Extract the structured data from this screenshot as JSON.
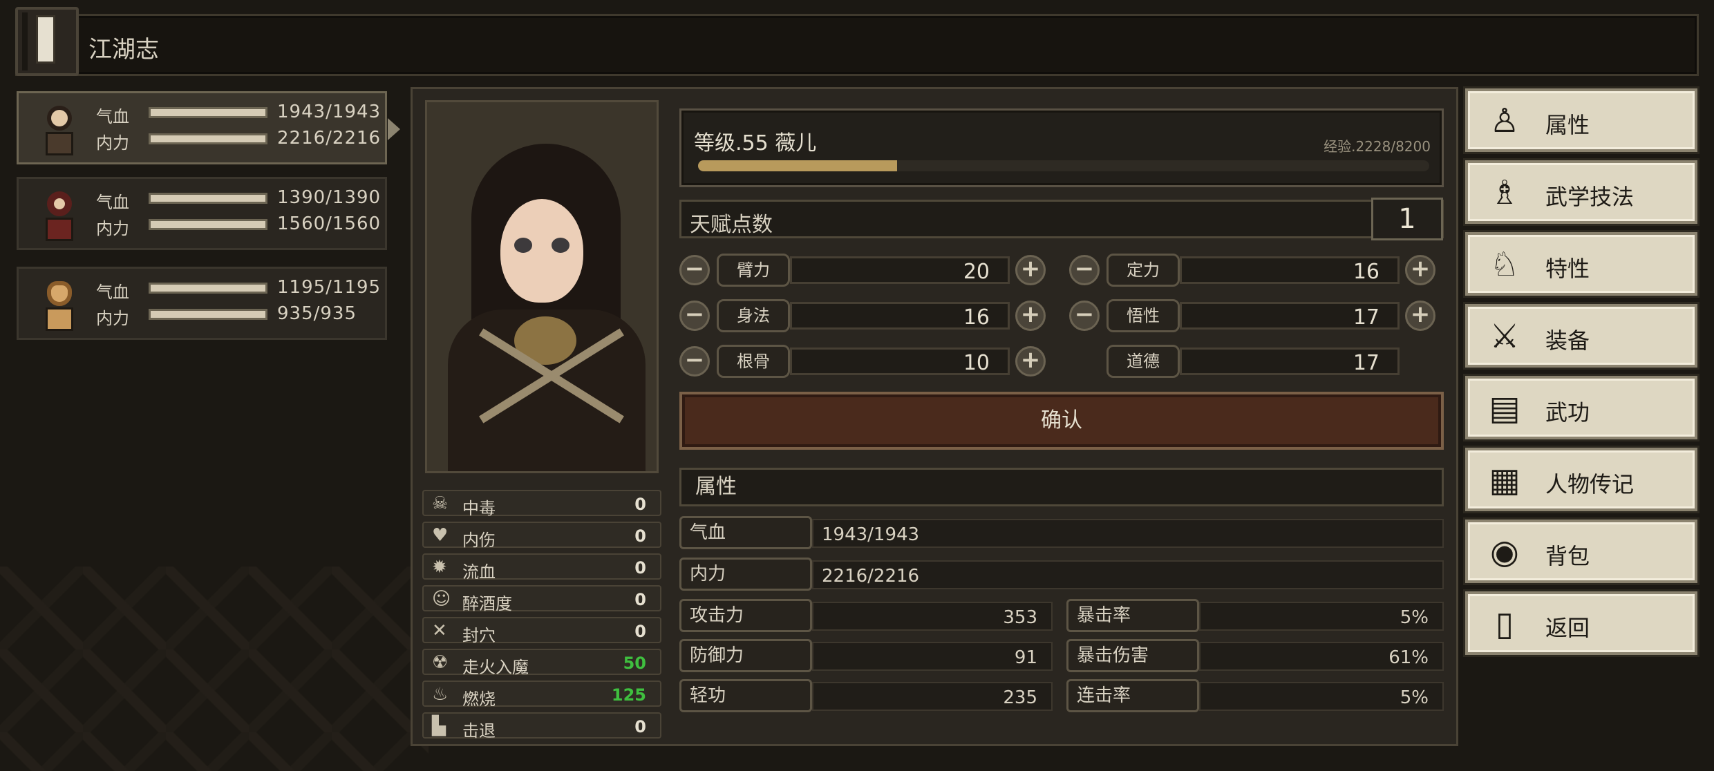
{
  "window": {
    "title": "江湖志"
  },
  "party": [
    {
      "hp_label": "气血",
      "hp_value": "1943/1943",
      "mp_label": "内力",
      "mp_value": "2216/2216",
      "active": true,
      "hp_fill": 1.0,
      "mp_fill": 1.0
    },
    {
      "hp_label": "气血",
      "hp_value": "1390/1390",
      "mp_label": "内力",
      "mp_value": "1560/1560",
      "active": false,
      "hp_fill": 1.0,
      "mp_fill": 1.0
    },
    {
      "hp_label": "气血",
      "hp_value": "1195/1195",
      "mp_label": "内力",
      "mp_value": "935/935",
      "active": false,
      "hp_fill": 1.0,
      "mp_fill": 1.0
    }
  ],
  "status_effects": [
    {
      "icon": "skull-icon",
      "glyph": "☠",
      "label": "中毒",
      "value": "0",
      "highlight": false
    },
    {
      "icon": "broken-heart-icon",
      "glyph": "♥",
      "label": "内伤",
      "value": "0",
      "highlight": false
    },
    {
      "icon": "blood-icon",
      "glyph": "✹",
      "label": "流血",
      "value": "0",
      "highlight": false
    },
    {
      "icon": "drunk-icon",
      "glyph": "☺",
      "label": "醉酒度",
      "value": "0",
      "highlight": false
    },
    {
      "icon": "acupoint-icon",
      "glyph": "✕",
      "label": "封穴",
      "value": "0",
      "highlight": false
    },
    {
      "icon": "demon-icon",
      "glyph": "☢",
      "label": "走火入魔",
      "value": "50",
      "highlight": true
    },
    {
      "icon": "fire-icon",
      "glyph": "♨",
      "label": "燃烧",
      "value": "125",
      "highlight": true
    },
    {
      "icon": "boot-icon",
      "glyph": "▙",
      "label": "击退",
      "value": "0",
      "highlight": false
    }
  ],
  "character": {
    "level_text": "等级.55  薇儿",
    "exp_text": "经验.2228/8200",
    "exp_fraction": 0.272
  },
  "talent": {
    "label": "天赋点数",
    "count": "1"
  },
  "attributes": {
    "left": [
      {
        "name": "臂力",
        "value": "20"
      },
      {
        "name": "身法",
        "value": "16"
      },
      {
        "name": "根骨",
        "value": "10"
      }
    ],
    "right": [
      {
        "name": "定力",
        "value": "16",
        "adjustable": true
      },
      {
        "name": "悟性",
        "value": "17",
        "adjustable": true
      },
      {
        "name": "道德",
        "value": "17",
        "adjustable": false
      }
    ]
  },
  "confirm_label": "确认",
  "properties": {
    "title": "属性",
    "hp": {
      "name": "气血",
      "value": "1943/1943"
    },
    "mp": {
      "name": "内力",
      "value": "2216/2216"
    },
    "left": [
      {
        "name": "攻击力",
        "value": "353"
      },
      {
        "name": "防御力",
        "value": "91"
      },
      {
        "name": "轻功",
        "value": "235"
      }
    ],
    "right": [
      {
        "name": "暴击率",
        "value": "5%"
      },
      {
        "name": "暴击伤害",
        "value": "61%"
      },
      {
        "name": "连击率",
        "value": "5%"
      }
    ]
  },
  "menu": [
    {
      "icon": "person-icon",
      "glyph": "♙",
      "label": "属性"
    },
    {
      "icon": "martial-skill-icon",
      "glyph": "♗",
      "label": "武学技法"
    },
    {
      "icon": "trait-icon",
      "glyph": "♘",
      "label": "特性"
    },
    {
      "icon": "sword-icon",
      "glyph": "⚔",
      "label": "装备"
    },
    {
      "icon": "book-icon",
      "glyph": "▤",
      "label": "武功"
    },
    {
      "icon": "scroll-icon",
      "glyph": "▦",
      "label": "人物传记"
    },
    {
      "icon": "bag-icon",
      "glyph": "◉",
      "label": "背包"
    },
    {
      "icon": "door-icon",
      "glyph": "▯",
      "label": "返回"
    }
  ],
  "colors": {
    "highlight_green": "#3fbf3f",
    "exp_bar": "#b89a5c",
    "confirm_bg": "#4a2a1c"
  }
}
